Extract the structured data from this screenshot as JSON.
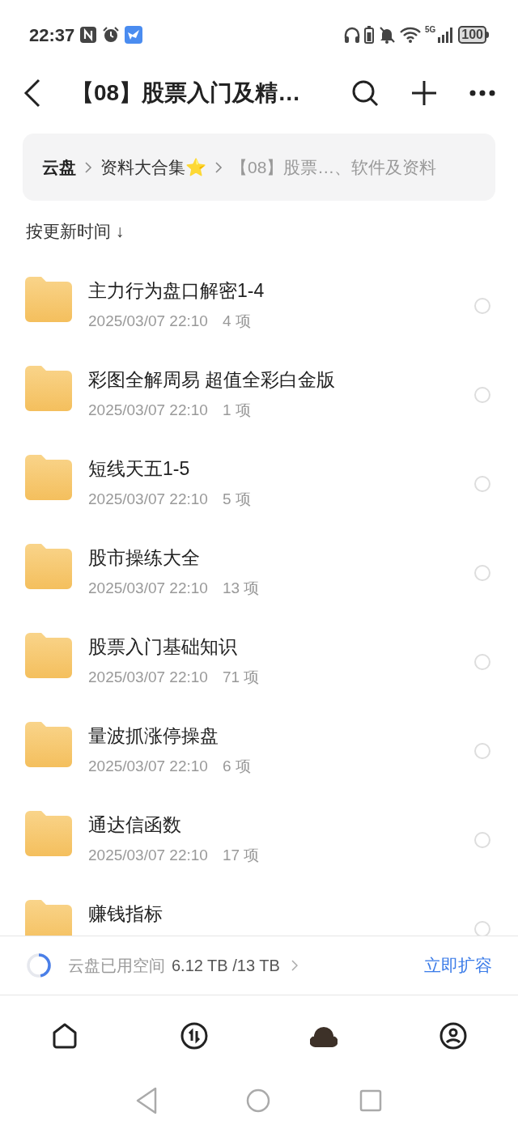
{
  "status_bar": {
    "time": "22:37",
    "network": "5G",
    "battery": "100"
  },
  "header": {
    "title": "【08】股票入门及精…"
  },
  "breadcrumbs": [
    {
      "label": "云盘",
      "current": false
    },
    {
      "label": "资料大合集⭐",
      "current": false
    },
    {
      "label": "【08】股票…、软件及资料",
      "current": true
    }
  ],
  "sort": {
    "label": "按更新时间 ↓"
  },
  "files": [
    {
      "name": "主力行为盘口解密1-4",
      "date": "2025/03/07 22:10",
      "count": "4 项",
      "selected": false
    },
    {
      "name": "彩图全解周易 超值全彩白金版",
      "date": "2025/03/07 22:10",
      "count": "1 项",
      "selected": false
    },
    {
      "name": "短线天五1-5",
      "date": "2025/03/07 22:10",
      "count": "5 项",
      "selected": false
    },
    {
      "name": "股市操练大全",
      "date": "2025/03/07 22:10",
      "count": "13 项",
      "selected": false
    },
    {
      "name": "股票入门基础知识",
      "date": "2025/03/07 22:10",
      "count": "71 项",
      "selected": false
    },
    {
      "name": "量波抓涨停操盘",
      "date": "2025/03/07 22:10",
      "count": "6 项",
      "selected": false
    },
    {
      "name": "通达信函数",
      "date": "2025/03/07 22:10",
      "count": "17 项",
      "selected": false
    },
    {
      "name": "赚钱指标",
      "selected": false
    }
  ],
  "storage": {
    "label": "云盘已用空间",
    "usage": "6.12 TB /13 TB",
    "level": 0.47,
    "action": "立即扩容"
  },
  "tabs": [
    {
      "kind": "home",
      "selected": false
    },
    {
      "kind": "transfer",
      "selected": false
    },
    {
      "kind": "cloud",
      "selected": true
    },
    {
      "kind": "profile",
      "selected": false
    }
  ]
}
